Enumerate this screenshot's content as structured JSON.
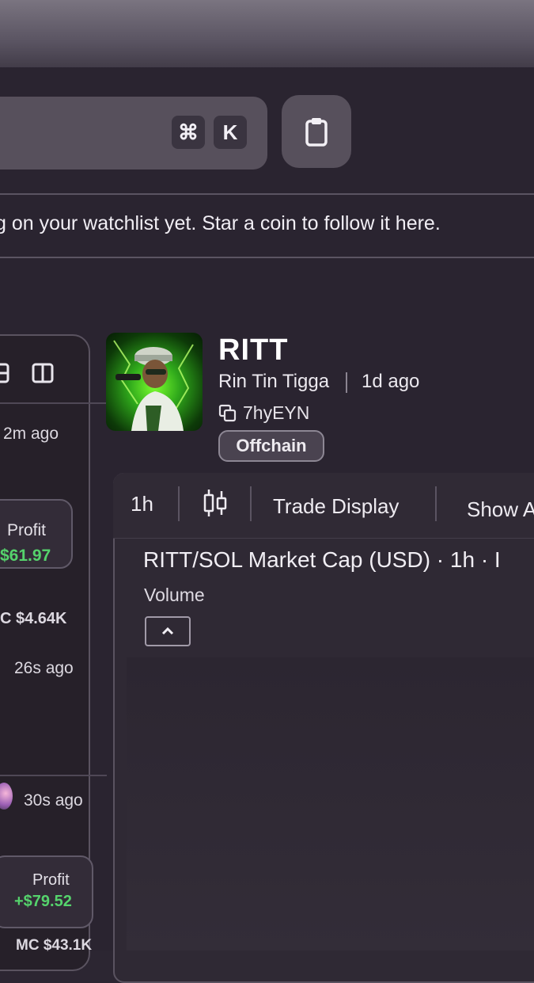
{
  "header": {
    "shortcut_cmd": "⌘",
    "shortcut_key": "K",
    "clipboard_icon": "clipboard-icon"
  },
  "watchlist": {
    "empty_message": "g on your watchlist yet. Star a coin to follow it here."
  },
  "sidebar": {
    "view_icons": [
      "list-view-icon",
      "columns-view-icon"
    ],
    "items": [
      {
        "time": "2m ago",
        "profit_label": "Profit",
        "profit_value": "$61.97",
        "mc": "C $4.64K"
      },
      {
        "time": "26s ago"
      },
      {
        "time": "30s ago",
        "profit_label": "Profit",
        "profit_value": "+$79.52",
        "mc": "MC $43.1K"
      }
    ]
  },
  "coin": {
    "ticker": "RITT",
    "name": "Rin Tin Tigga",
    "age": "1d ago",
    "address": "7hyEYN",
    "badge": "Offchain"
  },
  "chart": {
    "toolbar": {
      "interval": "1h",
      "candle_icon": "candlestick-icon",
      "trade_display": "Trade Display",
      "show": "Show A"
    },
    "title": "RITT/SOL Market Cap (USD) · 1h · I",
    "volume_label": "Volume"
  },
  "colors": {
    "profit_green": "#55d36c",
    "panel_border": "#5a5360",
    "background": "#2a2430"
  }
}
